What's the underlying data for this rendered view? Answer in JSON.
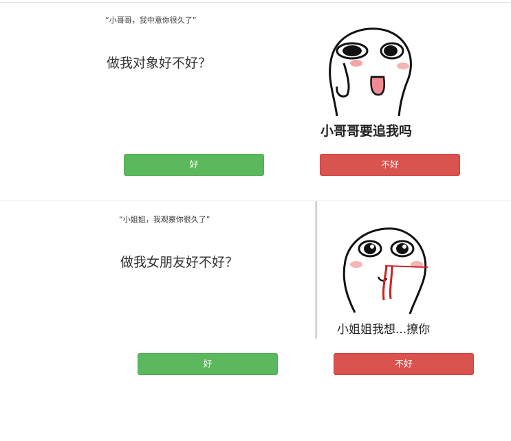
{
  "section1": {
    "quote": "“小哥哥，我中意你很久了”",
    "question": "做我对象好不好？",
    "meme_caption": "小哥哥要追我吗",
    "yes_label": "好",
    "no_label": "不好"
  },
  "section2": {
    "quote": "“小姐姐，我观察你很久了”",
    "question": "做我女朋友好不好？",
    "meme_caption": "小姐姐我想...撩你",
    "yes_label": "好",
    "no_label": "不好"
  },
  "colors": {
    "ok_button": "#5cb85c",
    "no_button": "#d9534f"
  }
}
